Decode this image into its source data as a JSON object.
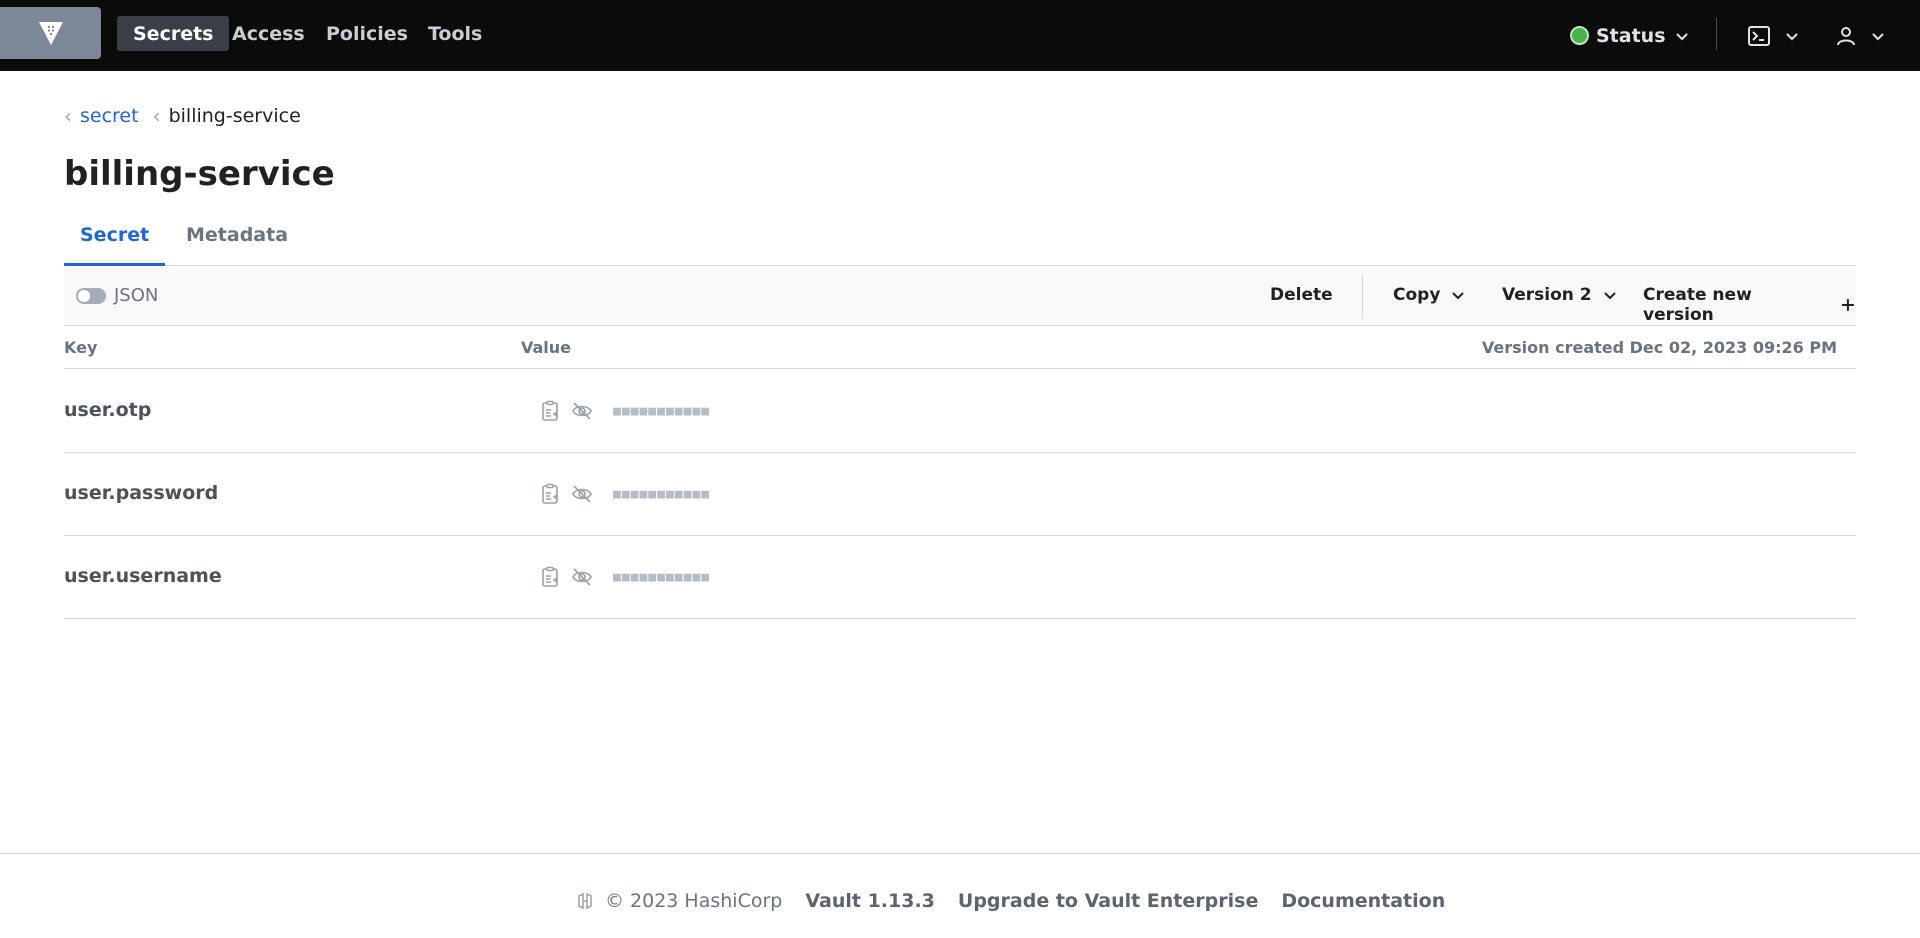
{
  "nav": {
    "items": [
      {
        "label": "Secrets",
        "active": true
      },
      {
        "label": "Access",
        "active": false
      },
      {
        "label": "Policies",
        "active": false
      },
      {
        "label": "Tools",
        "active": false
      }
    ],
    "status_label": "Status",
    "status_color": "#4caf50"
  },
  "breadcrumb": {
    "parent": "secret",
    "current": "billing-service"
  },
  "page": {
    "title": "billing-service"
  },
  "tabs": [
    {
      "label": "Secret",
      "active": true
    },
    {
      "label": "Metadata",
      "active": false
    }
  ],
  "toolbar": {
    "json_toggle_label": "JSON",
    "json_toggle_on": false,
    "delete_label": "Delete",
    "copy_label": "Copy",
    "version_label": "Version 2",
    "create_label": "Create new version"
  },
  "table": {
    "key_header": "Key",
    "value_header": "Value",
    "version_created": "Version created Dec 02, 2023 09:26 PM",
    "rows": [
      {
        "key": "user.otp",
        "masked": "■■■■■■■■■■■"
      },
      {
        "key": "user.password",
        "masked": "■■■■■■■■■■■"
      },
      {
        "key": "user.username",
        "masked": "■■■■■■■■■■■"
      }
    ]
  },
  "footer": {
    "copyright": "© 2023 HashiCorp",
    "version": "Vault 1.13.3",
    "upgrade": "Upgrade to Vault Enterprise",
    "docs": "Documentation"
  },
  "colors": {
    "accent": "#1f66d6",
    "nav_bg": "#0b0b0c"
  }
}
